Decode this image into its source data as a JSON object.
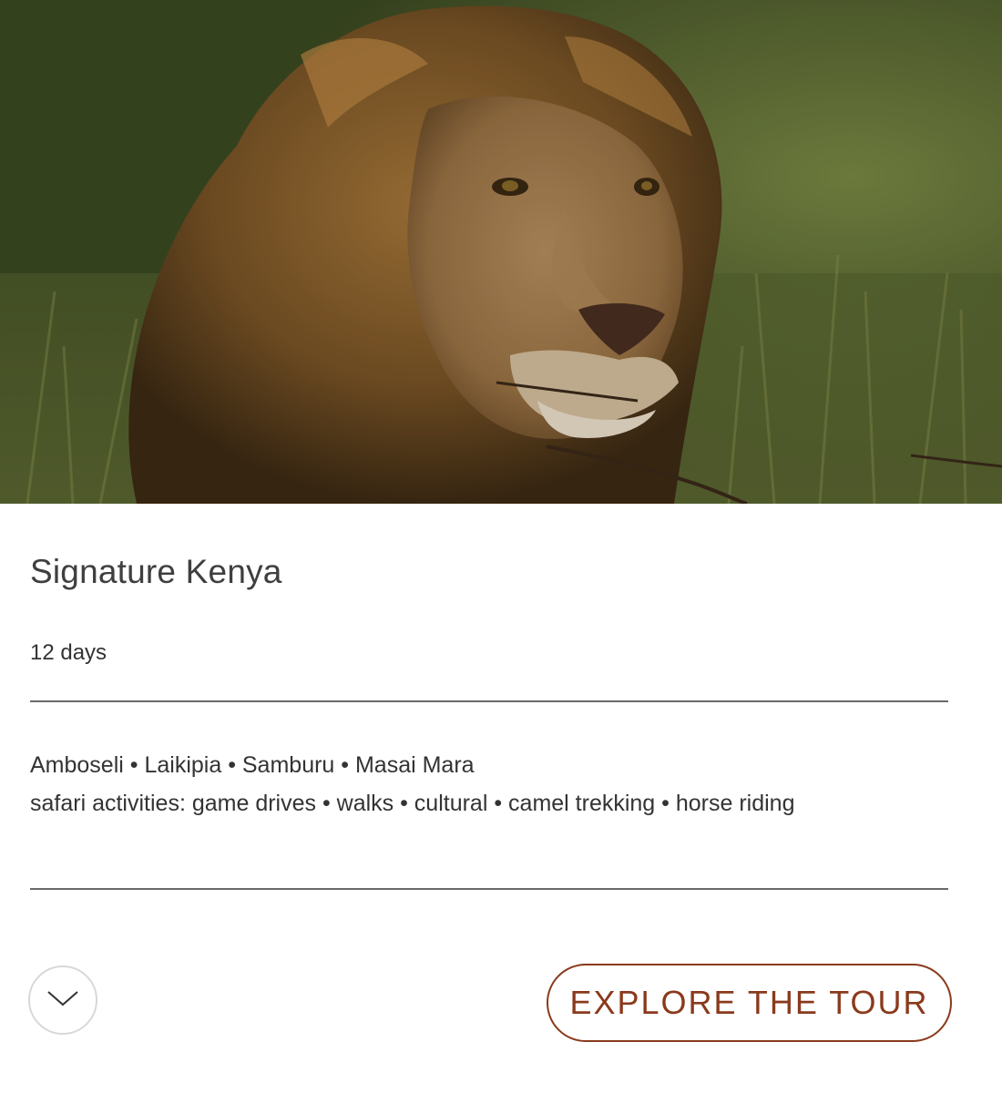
{
  "hero": {
    "subject": "lion-photo"
  },
  "tour": {
    "title": "Signature Kenya",
    "duration": "12 days",
    "destinations": "Amboseli • Laikipia • Samburu • Masai Mara",
    "activities": "safari activities: game drives • walks • cultural • camel trekking • horse riding"
  },
  "actions": {
    "expand_icon": "chevron-down-icon",
    "explore_label": "EXPLORE THE TOUR"
  },
  "colors": {
    "accent": "#8a3a1c",
    "text": "#333333",
    "divider": "#6a6a6a"
  }
}
